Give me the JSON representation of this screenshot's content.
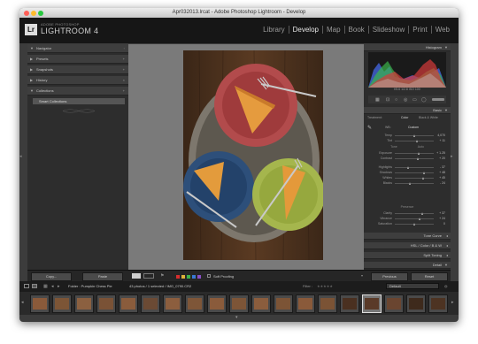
{
  "window": {
    "title": "Apr032013.lrcat - Adobe Photoshop Lightroom - Develop",
    "traffic_lights": [
      "#ff5f57",
      "#febc2e",
      "#28c840"
    ]
  },
  "brand": {
    "logo_text": "Lr",
    "small": "ADOBE PHOTOSHOP",
    "big": "LIGHTROOM 4"
  },
  "modules": [
    {
      "label": "Library",
      "active": false
    },
    {
      "label": "Develop",
      "active": true
    },
    {
      "label": "Map",
      "active": false
    },
    {
      "label": "Book",
      "active": false
    },
    {
      "label": "Slideshow",
      "active": false
    },
    {
      "label": "Print",
      "active": false
    },
    {
      "label": "Web",
      "active": false
    }
  ],
  "left_panel": {
    "sections": [
      "Navigator",
      "Presets",
      "Snapshots",
      "History",
      "Collections"
    ],
    "collection_item": "Smart Collections"
  },
  "right_panel": {
    "histogram_label": "Histogram",
    "histogram_info": "f/5.6   1/2.8 ISO 100",
    "basic_label": "Basic",
    "treatment_label": "Treatment:",
    "treatment_options": [
      "Color",
      "Black & White"
    ],
    "wb_label": "WB:",
    "wb_value": "Custom",
    "tone_label": "Tone",
    "tone_auto": "Auto",
    "presence_label": "Presence",
    "sliders_wb": [
      {
        "label": "Temp",
        "value": "4,070"
      },
      {
        "label": "Tint",
        "value": "+ 11"
      }
    ],
    "sliders_tone": [
      {
        "label": "Exposure",
        "value": "+ 1.25"
      },
      {
        "label": "Contrast",
        "value": "+ 20"
      },
      {
        "label": "Highlights",
        "value": "- 37"
      },
      {
        "label": "Shadows",
        "value": "+ 48"
      },
      {
        "label": "Whites",
        "value": "+ 45"
      },
      {
        "label": "Blacks",
        "value": "- 24"
      }
    ],
    "sliders_presence": [
      {
        "label": "Clarity",
        "value": "+ 37"
      },
      {
        "label": "Vibrance",
        "value": "+ 24"
      },
      {
        "label": "Saturation",
        "value": "0"
      }
    ],
    "panels": [
      "Tone Curve",
      "HSL / Color / B & W",
      "Split Toning",
      "Detail"
    ]
  },
  "bottom_toolbar": {
    "copy": "Copy...",
    "paste": "Paste",
    "soft_proofing": "Soft Proofing",
    "previous": "Previous",
    "reset": "Reset",
    "color_labels": [
      "#d62e2e",
      "#e0b43a",
      "#3cb34a",
      "#3a78d6",
      "#8a4fc7"
    ]
  },
  "film_bar": {
    "folder_label": "Folder : Pumpkin Chess Pie",
    "count_label": "43 photos / 1 selected / IMG_0790.CR2",
    "filter_label": "Filter :",
    "filter_value": "Default"
  }
}
